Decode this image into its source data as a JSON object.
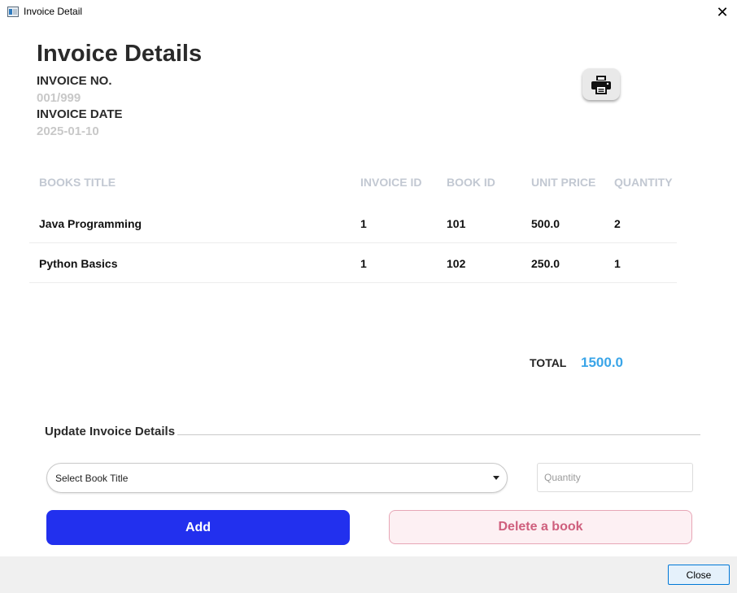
{
  "window": {
    "title": "Invoice Detail",
    "close_glyph": "✕"
  },
  "header": {
    "title": "Invoice Details",
    "invoice_no_label": "INVOICE NO.",
    "invoice_no_value": "001/999",
    "invoice_date_label": "INVOICE DATE",
    "invoice_date_value": "2025-01-10",
    "print_icon": "printer-icon"
  },
  "table": {
    "columns": [
      "BOOKS TITLE",
      "INVOICE ID",
      "BOOK ID",
      "UNIT PRICE",
      "QUANTITY"
    ],
    "rows": [
      [
        "Java Programming",
        "1",
        "101",
        "500.0",
        "2"
      ],
      [
        "Python Basics",
        "1",
        "102",
        "250.0",
        "1"
      ]
    ]
  },
  "total": {
    "label": "TOTAL",
    "value": "1500.0",
    "color": "#3aa5e8"
  },
  "update": {
    "section_title": "Update Invoice Details",
    "select_placeholder": "Select Book Title",
    "quantity_placeholder": "Quantity",
    "add_label": "Add",
    "delete_label": "Delete a book",
    "add_color": "#2230ee",
    "delete_color": "#cf5f7d"
  },
  "footer": {
    "close_label": "Close"
  }
}
